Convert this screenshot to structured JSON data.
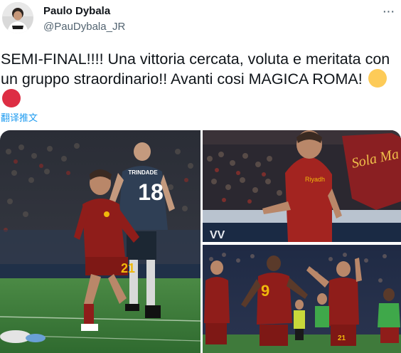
{
  "author": {
    "name": "Paulo Dybala",
    "handle": "@PauDybala_JR"
  },
  "tweet": {
    "text": "SEMI-FINAL!!!! Una vittoria cercata, voluta e meritata con un gruppo straordinario!! Avanti cosi MAGICA ROMA!",
    "emoji": [
      "yellow-circle",
      "red-circle"
    ],
    "translate_label": "翻译推文"
  },
  "more_label": "···",
  "photos": {
    "main": {
      "opponent_name": "TRINDADE",
      "opponent_number": "18",
      "player_number": "21"
    },
    "top_right": {
      "banner_text": "Sola Ma",
      "sponsor": "Riyadh",
      "board_text": "VV"
    },
    "bottom_right": {
      "number_left": "9",
      "number_right": "21"
    }
  },
  "colors": {
    "roma_red": "#8f1d1a",
    "roma_gold": "#f0b90b",
    "pitch": "#3f7a3b",
    "link_blue": "#1d9bf0",
    "emoji_yellow": "#fdcb58",
    "emoji_red": "#dd2e44"
  }
}
